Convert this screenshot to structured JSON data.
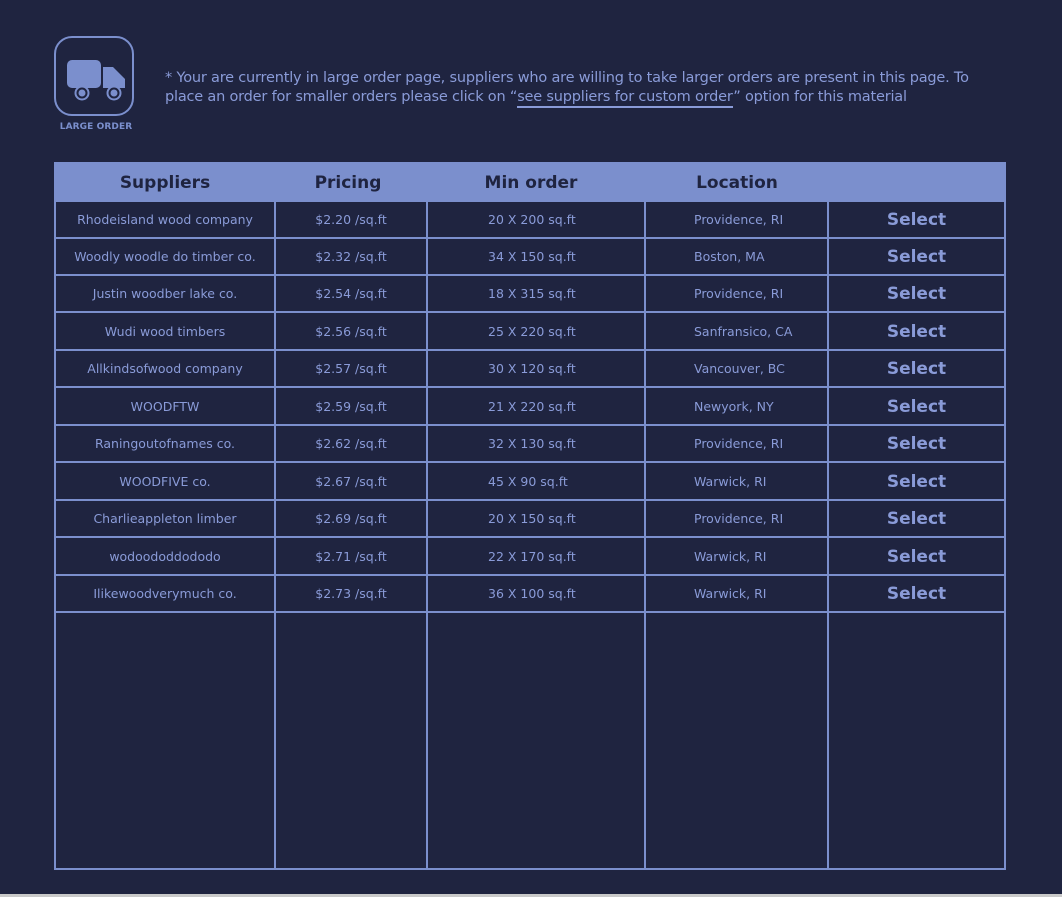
{
  "badge": {
    "icon": "truck-icon",
    "label": "LARGE ORDER"
  },
  "notice": {
    "before": "* Your are currently in large order page, suppliers who are willing to take larger orders are present in this page. To place an order for smaller orders please click on “",
    "link": "see suppliers for custom order",
    "after": "” option for this material"
  },
  "table": {
    "headers": [
      "Suppliers",
      "Pricing",
      "Min order",
      "Location",
      ""
    ],
    "select_label": "Select",
    "rows": [
      {
        "supplier": "Rhodeisland wood company",
        "price": "$2.20 /sq.ft",
        "min": "20 X 200 sq.ft",
        "loc": "Providence, RI"
      },
      {
        "supplier": "Woodly woodle do timber co.",
        "price": "$2.32 /sq.ft",
        "min": "34 X 150 sq.ft",
        "loc": "Boston, MA"
      },
      {
        "supplier": "Justin woodber lake co.",
        "price": "$2.54 /sq.ft",
        "min": "18 X 315 sq.ft",
        "loc": "Providence, RI"
      },
      {
        "supplier": "Wudi wood timbers",
        "price": "$2.56 /sq.ft",
        "min": "25 X 220 sq.ft",
        "loc": "Sanfransico, CA"
      },
      {
        "supplier": "Allkindsofwood company",
        "price": "$2.57 /sq.ft",
        "min": "30 X 120 sq.ft",
        "loc": "Vancouver, BC"
      },
      {
        "supplier": "WOODFTW",
        "price": "$2.59 /sq.ft",
        "min": "21 X 220 sq.ft",
        "loc": "Newyork, NY"
      },
      {
        "supplier": "Raningoutofnames co.",
        "price": "$2.62 /sq.ft",
        "min": "32 X 130 sq.ft",
        "loc": "Providence, RI"
      },
      {
        "supplier": "WOODFIVE co.",
        "price": "$2.67 /sq.ft",
        "min": "45 X 90 sq.ft",
        "loc": "Warwick, RI"
      },
      {
        "supplier": "Charlieappleton limber",
        "price": "$2.69 /sq.ft",
        "min": "20 X 150 sq.ft",
        "loc": "Providence, RI"
      },
      {
        "supplier": "wodoododdododo",
        "price": "$2.71 /sq.ft",
        "min": "22 X 170 sq.ft",
        "loc": "Warwick, RI"
      },
      {
        "supplier": "Ilikewoodverymuch co.",
        "price": "$2.73 /sq.ft",
        "min": "36 X 100 sq.ft",
        "loc": "Warwick, RI"
      }
    ]
  },
  "colors": {
    "background": "#1f2440",
    "accent": "#7b8fcd",
    "text": "#8a9bd8"
  }
}
